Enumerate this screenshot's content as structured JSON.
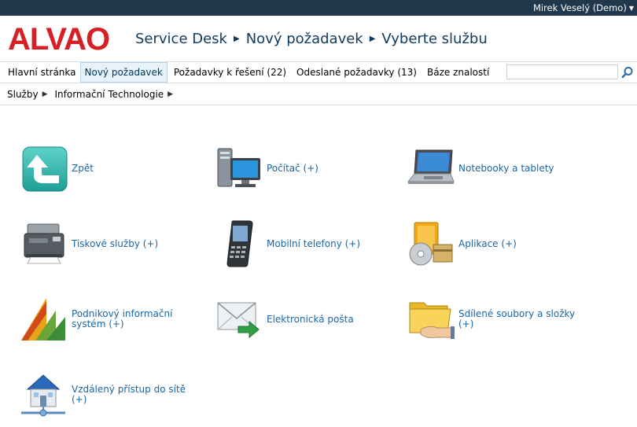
{
  "topbar": {
    "user": "Mirek Veselý (Demo)"
  },
  "header": {
    "logo_text": "ALVAO",
    "crumbs": [
      "Service Desk",
      "Nový požadavek",
      "Vyberte službu"
    ]
  },
  "nav": {
    "tabs": [
      "Hlavní stránka",
      "Nový požadavek",
      "Požadavky k řešení (22)",
      "Odeslané požadavky (13)",
      "Báze znalostí"
    ],
    "search_placeholder": ""
  },
  "subnav": {
    "crumbs": [
      "Služby",
      "Informační Technologie"
    ]
  },
  "services": [
    {
      "label": "Zpět",
      "icon": "back-arrow-icon"
    },
    {
      "label": "Počítač (+)",
      "icon": "computer-icon"
    },
    {
      "label": "Notebooky a tablety",
      "icon": "laptop-icon"
    },
    {
      "label": "Tiskové služby (+)",
      "icon": "printer-icon"
    },
    {
      "label": "Mobilní telefony (+)",
      "icon": "mobile-phone-icon"
    },
    {
      "label": "Aplikace (+)",
      "icon": "applications-icon"
    },
    {
      "label": "Podnikový informační systém (+)",
      "icon": "erp-chart-icon"
    },
    {
      "label": "Elektronická pošta",
      "icon": "email-icon"
    },
    {
      "label": "Sdílené soubory a složky (+)",
      "icon": "shared-folder-icon"
    },
    {
      "label": "Vzdálený přístup do sítě (+)",
      "icon": "remote-network-icon"
    }
  ]
}
